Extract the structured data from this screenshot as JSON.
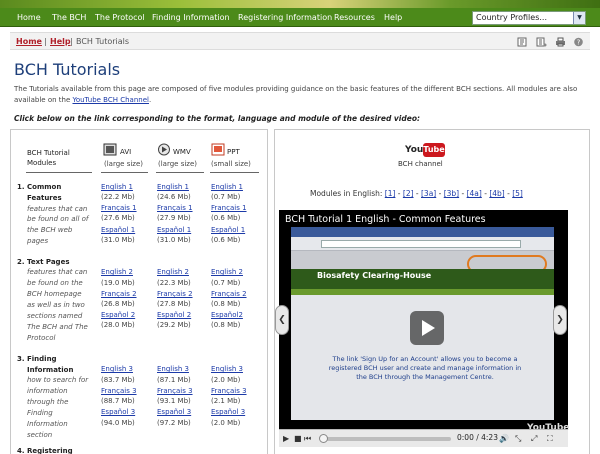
{
  "nav": {
    "items": [
      "Home",
      "The BCH",
      "The Protocol",
      "Finding Information",
      "Registering Information",
      "Resources",
      "Help"
    ],
    "country_select": "Country Profiles..."
  },
  "breadcrumb": {
    "home": "Home",
    "sep1": "|",
    "help": "Help",
    "sep2": "|",
    "current": "BCH Tutorials"
  },
  "page": {
    "title": "BCH Tutorials",
    "intro_text": "The Tutorials available from this page are composed of five modules providing guidance on the basic features of the different BCH sections. All modules are also available on the ",
    "intro_link": "YouTube BCH Channel",
    "intro_end": ".",
    "instruction": "Click below on the link corresponding to the format, language and module of the desired video:"
  },
  "table": {
    "header": {
      "col1_line1": "BCH Tutorial",
      "col1_line2": "Modules",
      "avi_label": "AVI",
      "avi_size": "(large size)",
      "wmv_label": "WMV",
      "wmv_size": "(large size)",
      "ppt_label": "PPT",
      "ppt_size": "(small size)"
    },
    "modules": [
      {
        "number": "1.",
        "title_lines": [
          "Common",
          "Features"
        ],
        "desc_lines": [
          "features that can",
          "be found on all of",
          "the BCH web",
          "pages"
        ],
        "links": [
          {
            "avi": "English 1",
            "avi_size": "(22.2 Mb)",
            "wmv": "English 1",
            "wmv_size": "(24.6 Mb)",
            "ppt": "English 1",
            "ppt_size": "(0.7 Mb)"
          },
          {
            "avi": "Français 1",
            "avi_size": "(27.6 Mb)",
            "wmv": "Français 1",
            "wmv_size": "(27.9 Mb)",
            "ppt": "Français 1",
            "ppt_size": "(0.6 Mb)"
          },
          {
            "avi": "Español 1",
            "avi_size": "(31.0 Mb)",
            "wmv": "Español 1",
            "wmv_size": "(31.0 Mb)",
            "ppt": "Español 1",
            "ppt_size": "(0.6 Mb)"
          }
        ]
      },
      {
        "number": "2.",
        "title_lines": [
          "Text Pages"
        ],
        "desc_lines": [
          "features that can",
          "be found on the",
          "BCH homepage",
          "as well as in two",
          "sections named",
          "The BCH and The",
          "Protocol"
        ],
        "links": [
          {
            "avi": "English 2",
            "avi_size": "(19.0 Mb)",
            "wmv": "English 2",
            "wmv_size": "(22.3 Mb)",
            "ppt": "English 2",
            "ppt_size": "(0.7 Mb)"
          },
          {
            "avi": "Français 2",
            "avi_size": "(26.8 Mb)",
            "wmv": "Français 2",
            "wmv_size": "(27.8 Mb)",
            "ppt": "Français 2",
            "ppt_size": "(0.8 Mb)"
          },
          {
            "avi": "Español 2",
            "avi_size": "(28.0 Mb)",
            "wmv": "Español 2",
            "wmv_size": "(29.2 Mb)",
            "ppt": "Español2",
            "ppt_size": "(0.8 Mb)"
          }
        ]
      },
      {
        "number": "3.",
        "title_lines": [
          "Finding",
          "Information"
        ],
        "desc_lines": [
          "how to search for",
          "information",
          "through the",
          "Finding",
          "Information",
          "section"
        ],
        "links": [
          {
            "avi": "English 3",
            "avi_size": "(83.7 Mb)",
            "wmv": "English 3",
            "wmv_size": "(87.1 Mb)",
            "ppt": "English 3",
            "ppt_size": "(2.0 Mb)"
          },
          {
            "avi": "Français 3",
            "avi_size": "(88.7 Mb)",
            "wmv": "Français 3",
            "wmv_size": "(93.1 Mb)",
            "ppt": "Français 3",
            "ppt_size": "(2.1 Mb)"
          },
          {
            "avi": "Español 3",
            "avi_size": "(94.0 Mb)",
            "wmv": "Español 3",
            "wmv_size": "(97.2 Mb)",
            "ppt": "Español 3",
            "ppt_size": "(2.0 Mb)"
          }
        ]
      }
    ],
    "next_module_partial": "4. Registering"
  },
  "youtube": {
    "logo_you": "You",
    "logo_tube": "Tube",
    "channel_label": "BCH channel",
    "modules_prefix": "Modules in English: ",
    "module_links": [
      "[1]",
      "[2]",
      "[3a]",
      "[3b]",
      "[4a]",
      "[4b]",
      "[5]"
    ],
    "separator": " - ",
    "player": {
      "title": "BCH Tutorial 1 English - Common Features",
      "site_name": "Biosafety Clearing-House",
      "caption": "The link 'Sign Up for an Account' allows you to become a registered BCH user and create and manage information in the BCH through the Management Centre.",
      "watermark": "YouTube",
      "time": "0:00 / 4:23"
    }
  },
  "colors": {
    "nav_green": "#4c8a1a",
    "link_blue": "#1c3aa8",
    "title_blue": "#1e3f7a",
    "crumb_red": "#b0202a"
  }
}
